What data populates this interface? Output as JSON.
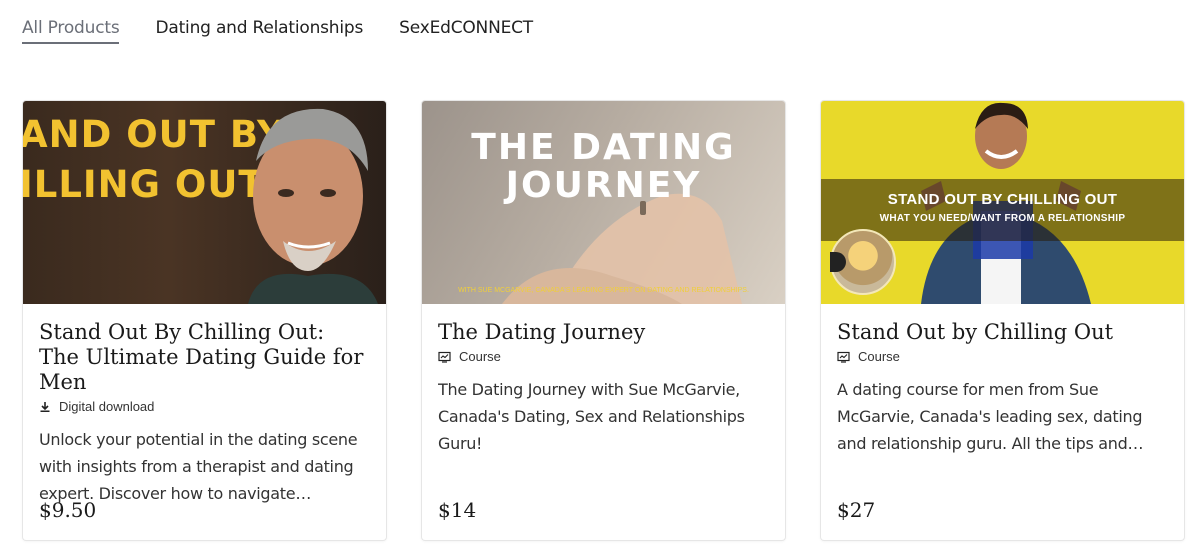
{
  "tabs": [
    {
      "label": "All Products",
      "active": true
    },
    {
      "label": "Dating and Relationships",
      "active": false
    },
    {
      "label": "SexEdCONNECT",
      "active": false
    }
  ],
  "products": [
    {
      "thumb_lines": [
        "AND OUT BY",
        "ILLING OUT"
      ],
      "title": "Stand Out By Chilling Out: The Ultimate Dating Guide for Men",
      "type": "Digital download",
      "type_icon": "download-icon",
      "description": "Unlock your potential in the dating scene with insights from a therapist and dating expert. Discover how to navigate romance…",
      "price": "$9.50"
    },
    {
      "thumb_lines": [
        "THE DATING",
        "JOURNEY"
      ],
      "thumb_caption": "WITH SUE MCGARVIE, CANADA'S LEADING EXPERT ON DATING AND RELATIONSHIPS.",
      "title": "The Dating Journey",
      "type": "Course",
      "type_icon": "course-icon",
      "description": "The Dating Journey with Sue McGarvie, Canada's Dating, Sex and Relationships Guru!",
      "price": "$14"
    },
    {
      "thumb_lines": [
        "STAND OUT BY CHILLING OUT",
        "WHAT YOU NEED/WANT FROM A RELATIONSHIP"
      ],
      "title": "Stand Out by Chilling Out",
      "type": "Course",
      "type_icon": "course-icon",
      "description": "A dating course for men from Sue McGarvie, Canada's leading sex, dating and relationship guru. All the tips and tricks to…",
      "price": "$27"
    }
  ],
  "colors": {
    "accent_yellow": "#f2c230",
    "tab_active": "#6b6f78"
  }
}
